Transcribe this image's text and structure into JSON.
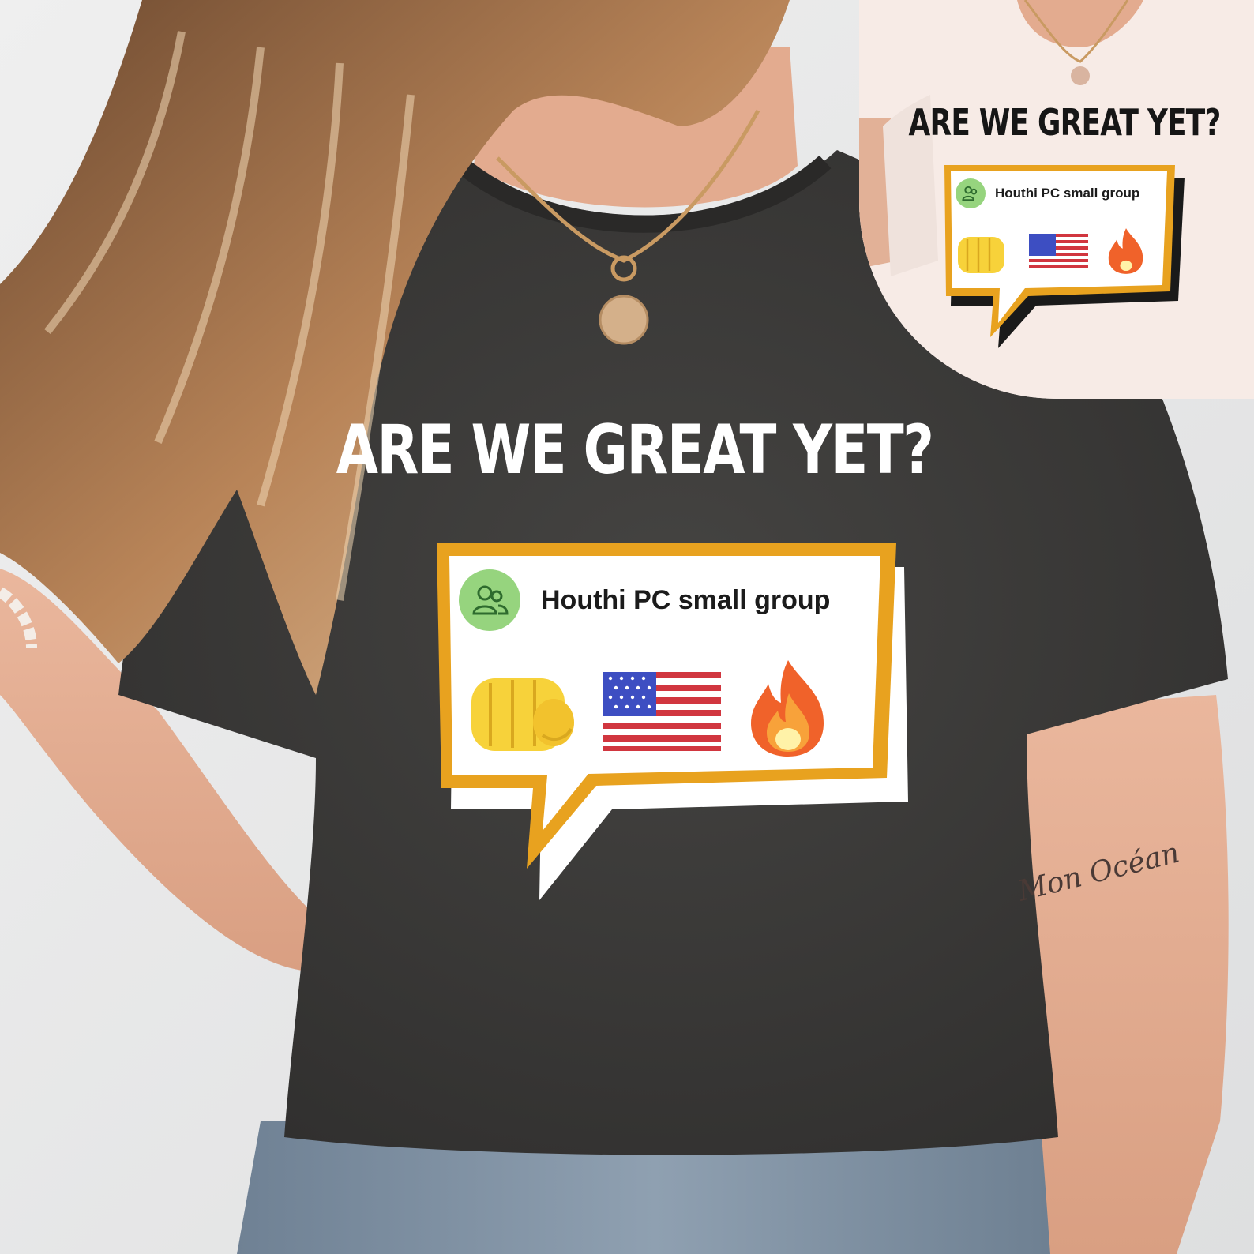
{
  "headline": "ARE WE GREAT YET?",
  "group_name": "Houthi PC small group",
  "emojis": [
    "fist-emoji",
    "us-flag-emoji",
    "fire-emoji"
  ],
  "inset": {
    "headline": "ARE WE GREAT YET?",
    "group_name": "Houthi PC small group"
  },
  "tattoo_text": "Mon Océan",
  "colors": {
    "shirt": "#3d3c3b",
    "bubble_border": "#e8a21f",
    "avatar_bg": "#96d47e",
    "text_on_shirt": "#ffffff",
    "inset_shirt": "#f7ebe6"
  }
}
